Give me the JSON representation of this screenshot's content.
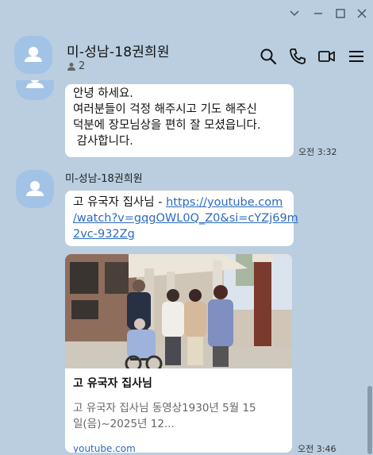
{
  "window": {
    "controls": [
      "chevron-down",
      "minimize",
      "maximize",
      "close"
    ]
  },
  "header": {
    "room_title": "미-성남-18권희원",
    "member_count": "2",
    "icons": [
      "search-icon",
      "phone-icon",
      "video-icon",
      "menu-icon"
    ]
  },
  "messages": [
    {
      "lines": [
        "안녕 하세요.",
        "여러분들이 걱정 해주시고 기도 해주신",
        "덕분에 장모님상을 편히 잘 모셨읍니다.",
        " 감사합니다."
      ],
      "time": "오전 3:32"
    },
    {
      "sender": "미-성남-18권희원",
      "text_prefix": "고 유국자 집사님 - ",
      "url_lines": [
        "https://youtube.com",
        "/watch?v=gqgOWL0Q_Z0&si=cYZj69m",
        "2vc-932Zg"
      ],
      "preview": {
        "title": "고 유국자 집사님",
        "description": [
          "고 유국자 집사님 동영상1930년 5월 15",
          "일(음)~2025년 12..."
        ],
        "domain": "youtube.com"
      },
      "time": "오전 3:46"
    }
  ]
}
